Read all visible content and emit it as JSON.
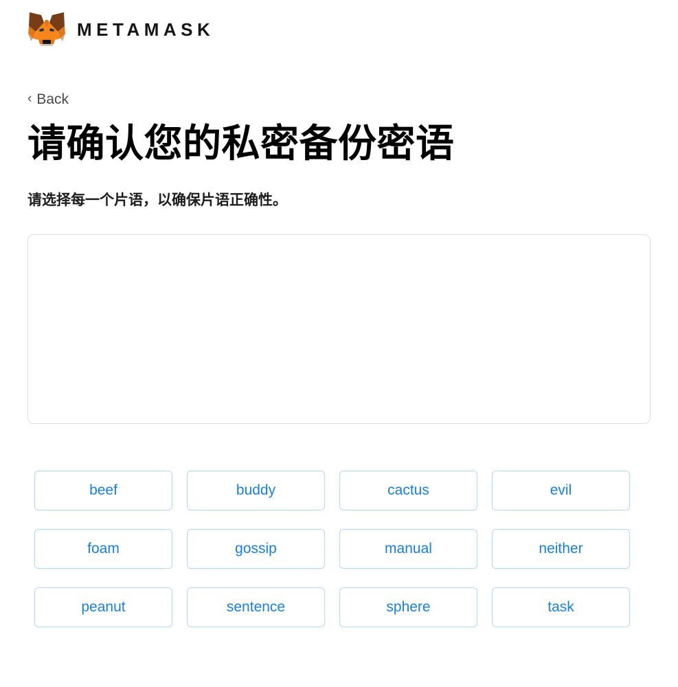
{
  "brand": {
    "logo_icon": "metamask-fox-icon",
    "wordmark": "METAMASK"
  },
  "nav": {
    "back_label": "Back",
    "back_icon": "chevron-left-icon"
  },
  "main": {
    "title": "请确认您的私密备份密语",
    "subtitle": "请选择每一个片语，以确保片语正确性。",
    "dropzone_name": "selected-seed-phrase-dropzone",
    "selected_words": []
  },
  "word_chips": [
    "beef",
    "buddy",
    "cactus",
    "evil",
    "foam",
    "gossip",
    "manual",
    "neither",
    "peanut",
    "sentence",
    "sphere",
    "task"
  ],
  "colors": {
    "chip_text": "#1b7fd9",
    "chip_border": "#b4d9f2",
    "dropzone_border": "#dedede",
    "wordmark": "#161616",
    "fox_orange": "#e2761b",
    "fox_dark": "#763d16",
    "fox_light": "#f6851b"
  }
}
